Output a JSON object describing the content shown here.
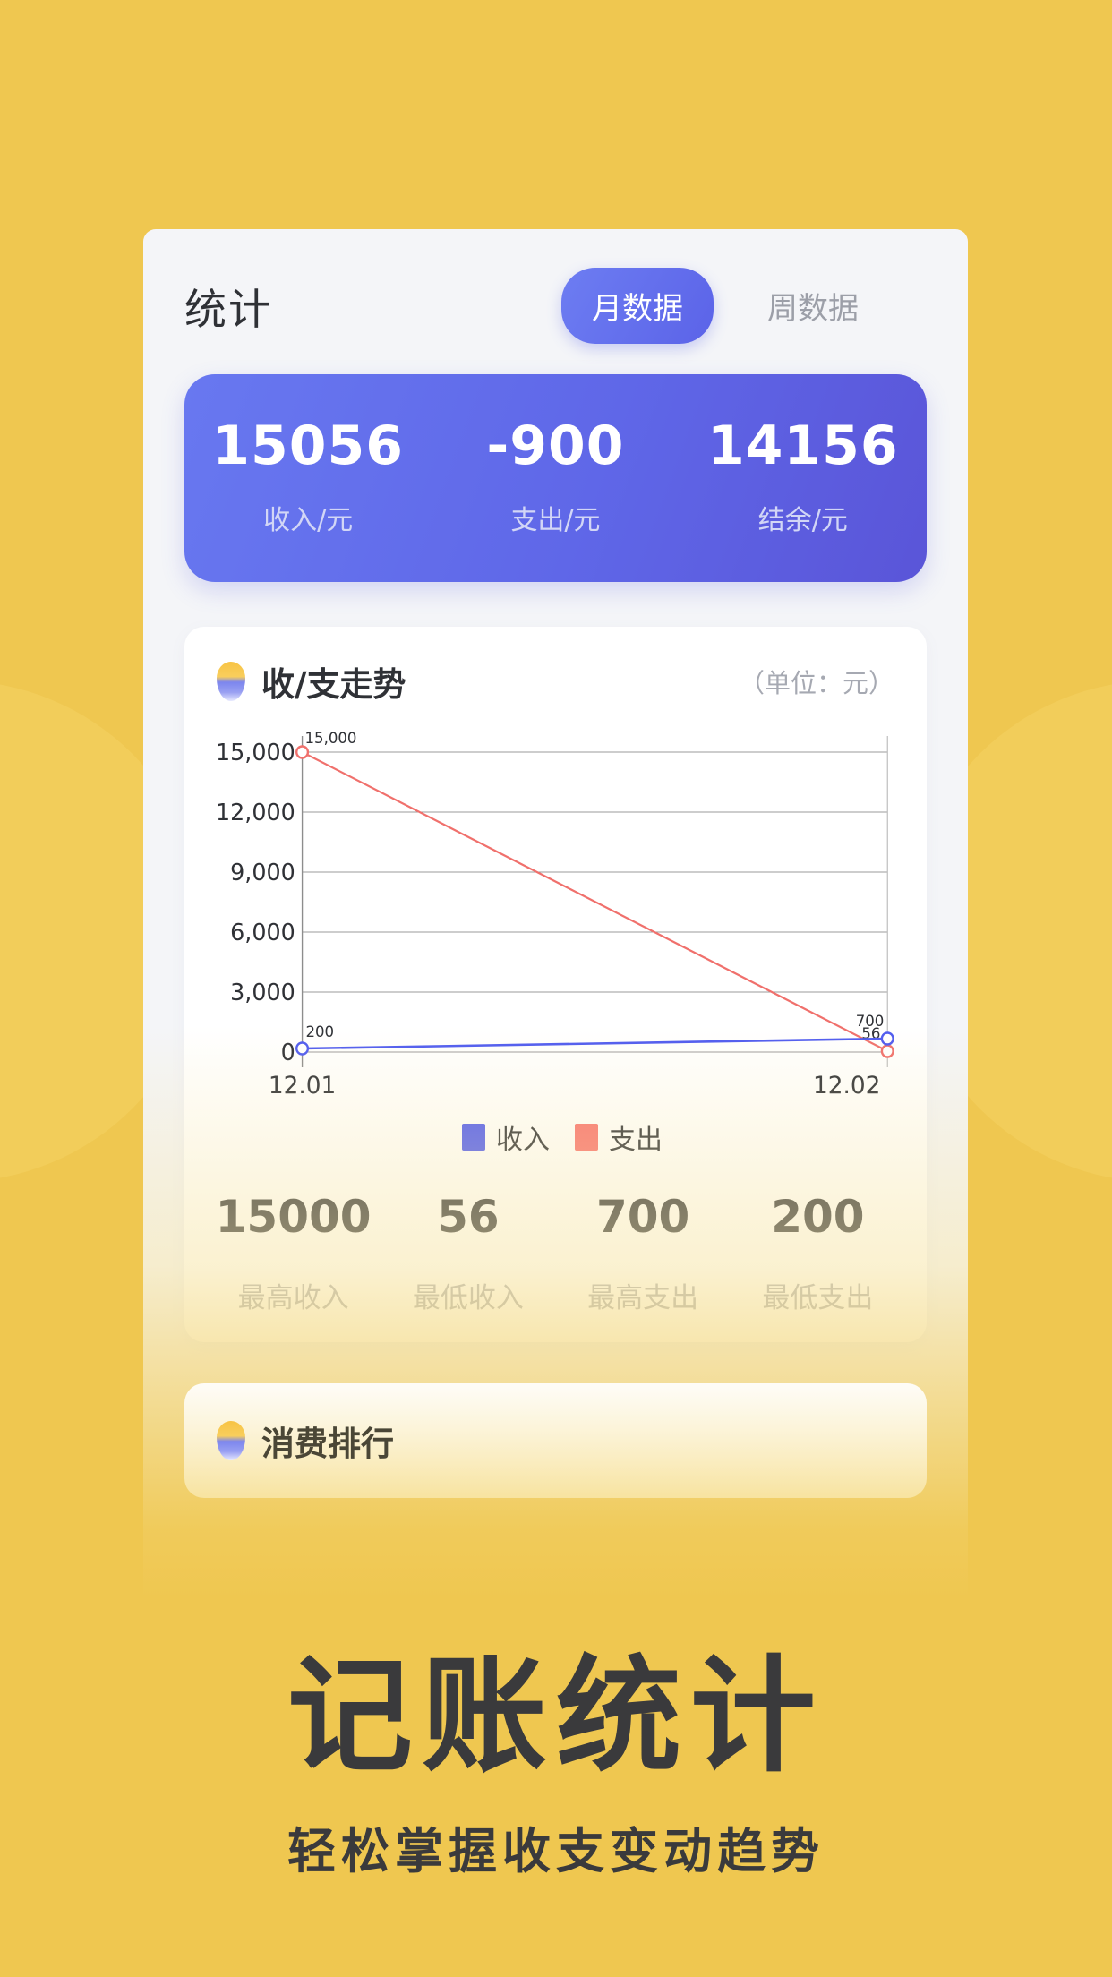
{
  "background": {
    "color": "#EFC750",
    "circle_color": "#F2CE5C"
  },
  "header": {
    "title": "统计",
    "tabs": [
      {
        "label": "月数据",
        "active": true
      },
      {
        "label": "周数据",
        "active": false
      }
    ]
  },
  "summary": {
    "items": [
      {
        "value": "15056",
        "label": "收入/元"
      },
      {
        "value": "-900",
        "label": "支出/元"
      },
      {
        "value": "14156",
        "label": "结余/元"
      }
    ]
  },
  "chart_card": {
    "icon": "seed-icon",
    "title": "收/支走势",
    "unit": "（单位：元）",
    "legend": [
      {
        "label": "收入",
        "color": "#4F5BF0"
      },
      {
        "label": "支出",
        "color": "#F8736F"
      }
    ],
    "stats": [
      {
        "value": "15000",
        "label": "最高收入"
      },
      {
        "value": "56",
        "label": "最低收入"
      },
      {
        "value": "700",
        "label": "最高支出"
      },
      {
        "value": "200",
        "label": "最低支出"
      }
    ]
  },
  "chart_data": {
    "type": "line",
    "title": "收/支走势",
    "xlabel": "",
    "ylabel": "",
    "unit": "元",
    "x": [
      "12.01",
      "12.02"
    ],
    "categories": [
      "12.01",
      "12.02"
    ],
    "ylim": [
      0,
      15000
    ],
    "yticks": [
      0,
      3000,
      6000,
      9000,
      12000,
      15000
    ],
    "ytick_labels": [
      "0",
      "3,000",
      "6,000",
      "9,000",
      "12,000",
      "15,000"
    ],
    "grid": true,
    "legend_position": "bottom-left",
    "series": [
      {
        "name": "收入",
        "color": "#4F5BF0",
        "values": [
          200,
          700
        ],
        "point_labels": [
          "200",
          "700"
        ]
      },
      {
        "name": "支出",
        "color": "#F8736F",
        "values": [
          15000,
          56
        ],
        "point_labels": [
          "15,000",
          "56"
        ]
      }
    ]
  },
  "rank_card": {
    "icon": "seed-icon",
    "title": "消费排行"
  },
  "promo": {
    "title": "记账统计",
    "subtitle": "轻松掌握收支变动趋势"
  }
}
